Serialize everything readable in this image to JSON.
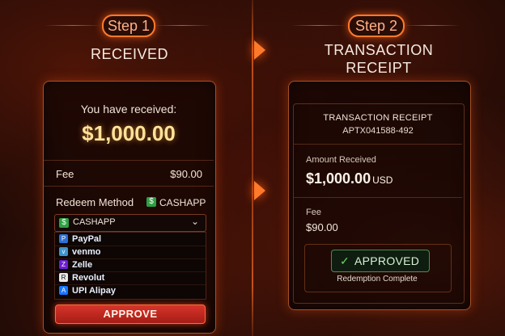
{
  "step1": {
    "pill": "Step 1",
    "title": "RECEIVED",
    "received_label": "You have received:",
    "amount": "$1,000.00",
    "fee_label": "Fee",
    "fee_value": "$90.00",
    "redeem_label": "Redeem Method",
    "redeem_value": "CASHAPP",
    "dropdown_selected": "CASHAPP",
    "options": [
      {
        "label": "PayPal",
        "icon": "paypal-icon",
        "color": "#2b6fd6"
      },
      {
        "label": "venmo",
        "icon": "venmo-icon",
        "color": "#3d95ce"
      },
      {
        "label": "Zelle",
        "icon": "zelle-icon",
        "color": "#6d1ed4"
      },
      {
        "label": "Revolut",
        "icon": "revolut-icon",
        "color": "#e8e8e8"
      },
      {
        "label": "UPI Alipay",
        "icon": "alipay-icon",
        "color": "#1677ff"
      }
    ],
    "approve_button": "APPROVE"
  },
  "step2": {
    "pill": "Step 2",
    "title_line1": "TRANSACTION",
    "title_line2": "RECEIPT",
    "receipt_heading": "TRANSACTION RECEIPT",
    "receipt_id": "APTX041588-492",
    "amount_label": "Amount Received",
    "amount": "$1,000.00",
    "currency": "USD",
    "fee_label": "Fee",
    "fee_value": "$90.00",
    "status": "APPROVED",
    "status_note": "Redemption Complete"
  },
  "colors": {
    "accent": "#ff7a2a",
    "approve_red": "#d8342a",
    "gold": "#ffe39a",
    "cashapp_green": "#2ea043",
    "approved_green": "#4caf50"
  }
}
